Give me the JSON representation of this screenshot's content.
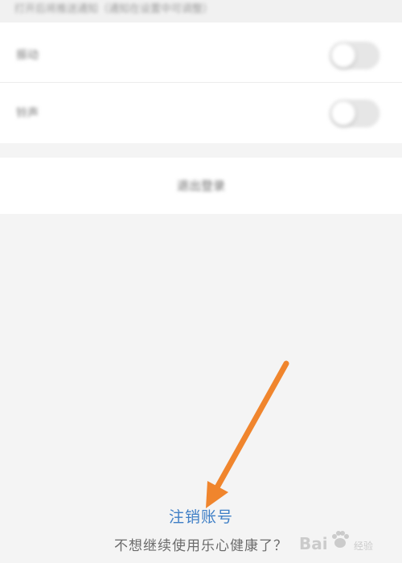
{
  "hint_strip": {
    "text": "打开后将推送通知（通知在设置中可调整）"
  },
  "settings": [
    {
      "label": "振动",
      "toggle_on": false
    },
    {
      "label": "铃声",
      "toggle_on": false
    }
  ],
  "action_button": {
    "label": "退出登录"
  },
  "cancel_account": {
    "link_label": "注销账号",
    "subtitle": "不想继续使用乐心健康了？"
  },
  "annotation": {
    "color": "#f0852d"
  },
  "watermark": {
    "text": "Bai",
    "sub": "经验"
  },
  "colors": {
    "background": "#f4f4f4",
    "link": "#3f7fc6",
    "arrow": "#f0852d"
  }
}
